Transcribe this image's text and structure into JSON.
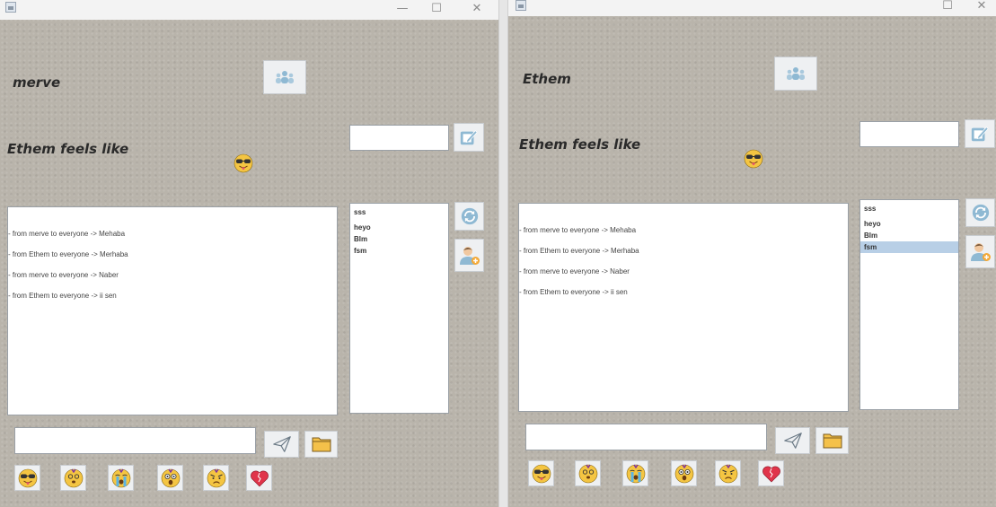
{
  "left": {
    "username": "merve",
    "feels_label": "Ethem  feels like",
    "messages": [
      "- from  merve   to everyone -> Mehaba",
      "- from  Ethem   to everyone -> Merhaba",
      "- from  merve   to everyone ->  Naber",
      "- from  Ethem   to everyone ->  ii sen"
    ],
    "users": [
      {
        "name": "sss",
        "selected": false
      },
      {
        "name": "heyo",
        "selected": false
      },
      {
        "name": "Blm",
        "selected": false
      },
      {
        "name": "fsm",
        "selected": false
      }
    ],
    "message_input_value": "",
    "status_input_value": ""
  },
  "right": {
    "username": "Ethem",
    "feels_label": "Ethem  feels like",
    "messages": [
      "- from  merve   to everyone -> Mehaba",
      "- from  Ethem   to everyone -> Merhaba",
      "- from  merve   to everyone ->  Naber",
      "- from  Ethem   to everyone ->  ii sen"
    ],
    "users": [
      {
        "name": "sss",
        "selected": false
      },
      {
        "name": "heyo",
        "selected": false
      },
      {
        "name": "Blm",
        "selected": false
      },
      {
        "name": "fsm",
        "selected": true
      }
    ],
    "message_input_value": "",
    "status_input_value": ""
  },
  "icons": {
    "app": "java-app-icon",
    "group": "group-users-icon",
    "edit": "edit-note-icon",
    "refresh": "refresh-icon",
    "add_user": "add-user-icon",
    "send": "send-paper-plane-icon",
    "folder": "folder-icon",
    "emojis": [
      "cool-tongue-emoji",
      "dizzy-emoji",
      "crying-emoji",
      "shocked-emoji",
      "angry-emoji",
      "broken-heart-emoji"
    ]
  },
  "colors": {
    "background": "#b9b4ab",
    "selection": "#b8cfe6",
    "icon_blue": "#8fb9d3",
    "folder": "#f4c14a",
    "emoji_face": "#f4c542",
    "heart": "#e0344a"
  }
}
